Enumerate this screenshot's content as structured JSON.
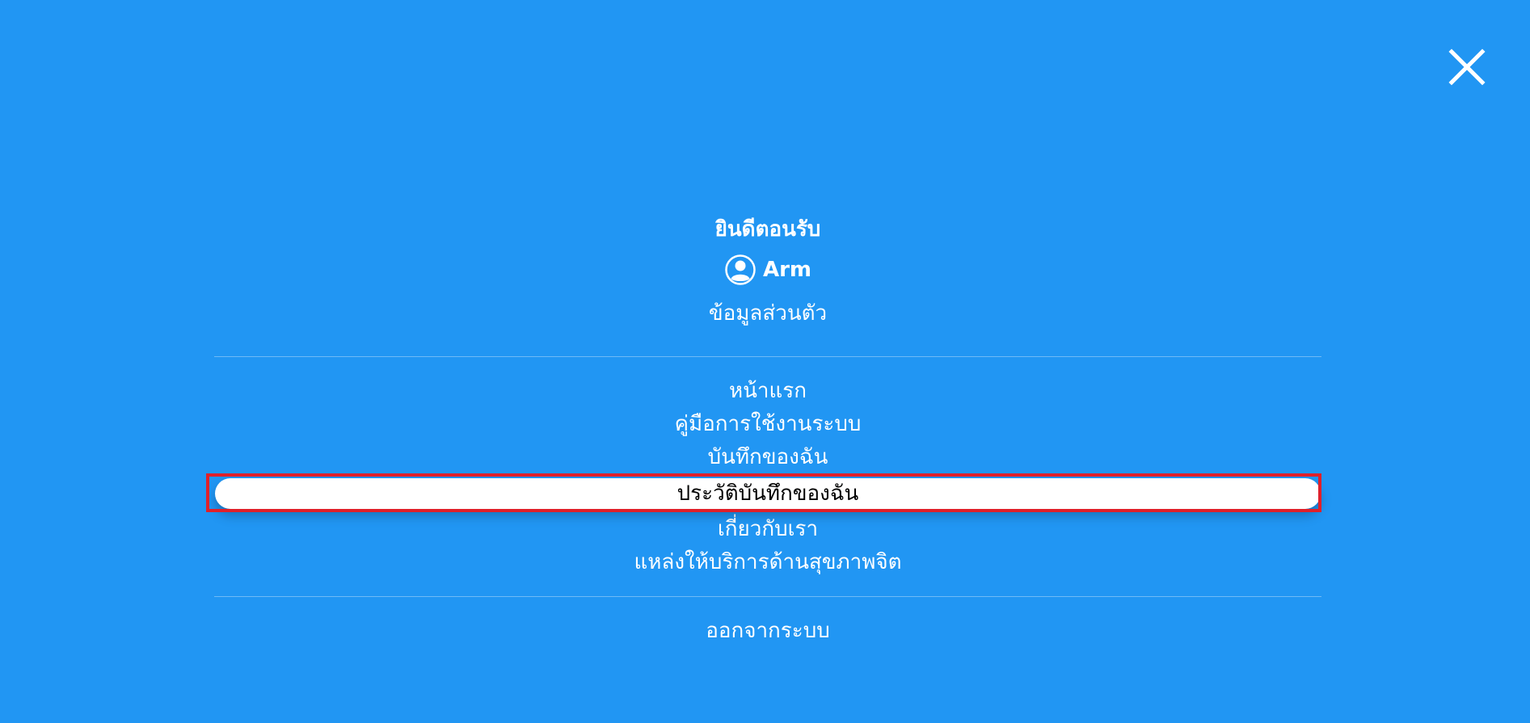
{
  "menu": {
    "welcome": "ยินดีตอนรับ",
    "user": {
      "name": "Arm",
      "icon": "user-circle-icon"
    },
    "profile_link": "ข้อมูลส่วนตัว",
    "nav_items": [
      "หน้าแรก",
      "คู่มือการใช้งานระบบ",
      "บันทึกของฉัน",
      "ประวัติบันทึกของฉัน",
      "เกี่ยวกับเรา",
      "แหล่งให้บริการด้านสุขภาพจิต"
    ],
    "active_index": 3,
    "logout": "ออกจากระบบ"
  },
  "colors": {
    "background": "#2196f3",
    "text": "#ffffff",
    "active_pill": "#ffffff",
    "active_text": "#000000",
    "highlight_border": "#e0202a"
  },
  "icons": {
    "close": "close-icon",
    "avatar": "user-circle-icon"
  }
}
